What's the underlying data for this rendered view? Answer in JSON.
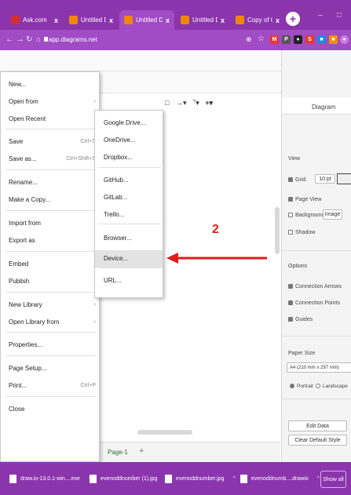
{
  "browser": {
    "tabs": [
      {
        "title": "Ask.com",
        "icon": "ask-icon",
        "icon_color": "#d32f2f"
      },
      {
        "title": "Untitled Diagram.d",
        "icon": "drawio-icon",
        "icon_color": "#f08705"
      },
      {
        "title": "Untitled Diagram.d",
        "icon": "drawio-icon",
        "icon_color": "#f08705"
      },
      {
        "title": "Untitled Diagram.d",
        "icon": "drawio-icon",
        "icon_color": "#f08705"
      },
      {
        "title": "Copy of Copy of U",
        "icon": "drawio-icon",
        "icon_color": "#f08705"
      }
    ],
    "close_glyph": "x",
    "newtab_glyph": "+",
    "url": "app.diagrams.net",
    "colors": {
      "frame": "#8b35ad",
      "toolbar": "#a14bc4"
    }
  },
  "file_menu": {
    "items": [
      {
        "label": "New...",
        "shortcut": "",
        "arrow": false
      },
      {
        "label": "Open from",
        "shortcut": "",
        "arrow": true
      },
      {
        "label": "Open Recent",
        "shortcut": "",
        "arrow": true
      },
      {
        "label": "Save",
        "shortcut": "Ctrl+S",
        "arrow": false
      },
      {
        "label": "Save as...",
        "shortcut": "Ctrl+Shift+S",
        "arrow": false
      },
      {
        "label": "Rename...",
        "shortcut": "",
        "arrow": false
      },
      {
        "label": "Make a Copy...",
        "shortcut": "",
        "arrow": false
      },
      {
        "label": "Import from",
        "shortcut": "",
        "arrow": true
      },
      {
        "label": "Export as",
        "shortcut": "",
        "arrow": true
      },
      {
        "label": "Embed",
        "shortcut": "",
        "arrow": true
      },
      {
        "label": "Publish",
        "shortcut": "",
        "arrow": true
      },
      {
        "label": "New Library",
        "shortcut": "",
        "arrow": true
      },
      {
        "label": "Open Library from",
        "shortcut": "",
        "arrow": true
      },
      {
        "label": "Properties...",
        "shortcut": "",
        "arrow": false
      },
      {
        "label": "Page Setup...",
        "shortcut": "",
        "arrow": false
      },
      {
        "label": "Print...",
        "shortcut": "Ctrl+P",
        "arrow": false
      },
      {
        "label": "Close",
        "shortcut": "",
        "arrow": false
      }
    ]
  },
  "import_submenu": {
    "items": [
      {
        "label": "Google Drive..."
      },
      {
        "label": "OneDrive..."
      },
      {
        "label": "Dropbox..."
      },
      {
        "label": "GitHub..."
      },
      {
        "label": "GitLab..."
      },
      {
        "label": "Trello..."
      },
      {
        "label": "Browser..."
      },
      {
        "label": "Device..."
      },
      {
        "label": "URL..."
      }
    ],
    "highlighted": "Device..."
  },
  "annotation": {
    "step_number": "2",
    "color": "#e21b1b"
  },
  "format_panel": {
    "title": "Diagram",
    "view_header": "View",
    "grid_label": "Grid",
    "grid_size": "10 pt",
    "page_view_label": "Page View",
    "background_label": "Background",
    "image_button": "Image",
    "shadow_label": "Shadow",
    "options_header": "Options",
    "connection_arrows": "Connection Arrows",
    "connection_points": "Connection Points",
    "guides": "Guides",
    "paper_size_header": "Paper Size",
    "paper_size_value": "A4 (210 mm x 297 mm)",
    "portrait": "Portrait",
    "landscape": "Landscape",
    "edit_data": "Edit Data",
    "clear_default_style": "Clear Default Style"
  },
  "page_bar": {
    "tab": "Page-1",
    "add_glyph": "+"
  },
  "downloads": [
    {
      "name": "draw.io-13.0.1-win....exe"
    },
    {
      "name": "evenoddnumber (1).jpg"
    },
    {
      "name": "evenoddnumber.jpg"
    },
    {
      "name": "evenoddnumb....drawio"
    }
  ],
  "show_all": "Show all"
}
